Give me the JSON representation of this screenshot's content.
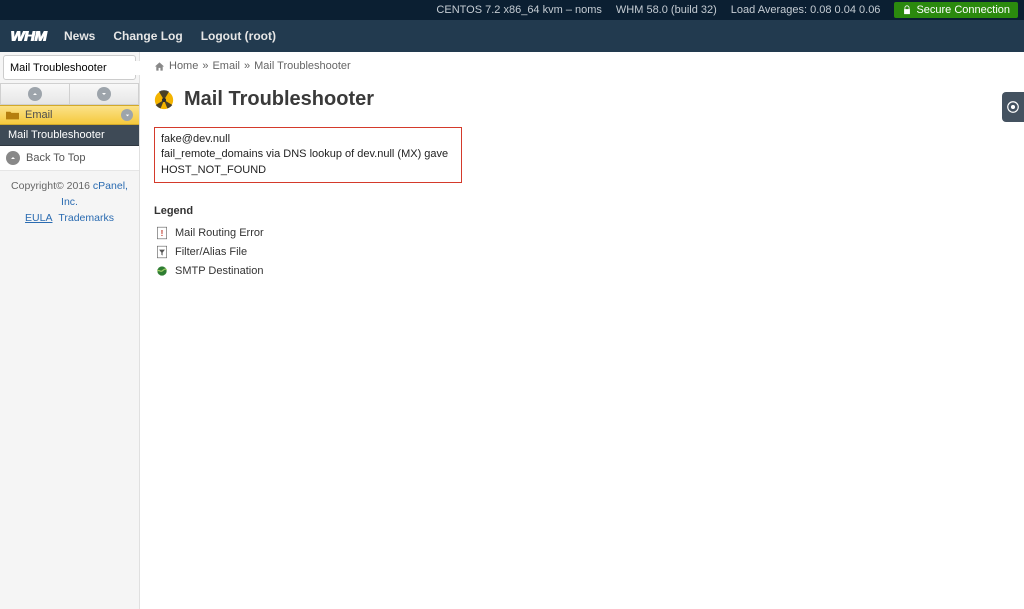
{
  "topbar": {
    "os": "CENTOS 7.2 x86_64 kvm – noms",
    "whm": "WHM 58.0 (build 32)",
    "load": "Load Averages: 0.08 0.04 0.06",
    "secure": "Secure Connection"
  },
  "nav": {
    "brand": "WHM",
    "links": [
      "News",
      "Change Log",
      "Logout (root)"
    ]
  },
  "sidebar": {
    "search_value": "Mail Troubleshooter",
    "category": "Email",
    "items": [
      "Mail Troubleshooter"
    ],
    "back_to_top": "Back To Top",
    "footer": {
      "copyright": "Copyright© 2016 ",
      "cpanel": "cPanel, Inc.",
      "eula": "EULA",
      "trademarks": "Trademarks"
    }
  },
  "breadcrumb": [
    "Home",
    "Email",
    "Mail Troubleshooter"
  ],
  "page": {
    "title": "Mail Troubleshooter",
    "result_lines": [
      "fake@dev.null",
      "fail_remote_domains via DNS lookup of dev.null (MX) gave HOST_NOT_FOUND"
    ],
    "legend_label": "Legend",
    "legend": [
      "Mail Routing Error",
      "Filter/Alias File",
      "SMTP Destination"
    ]
  }
}
